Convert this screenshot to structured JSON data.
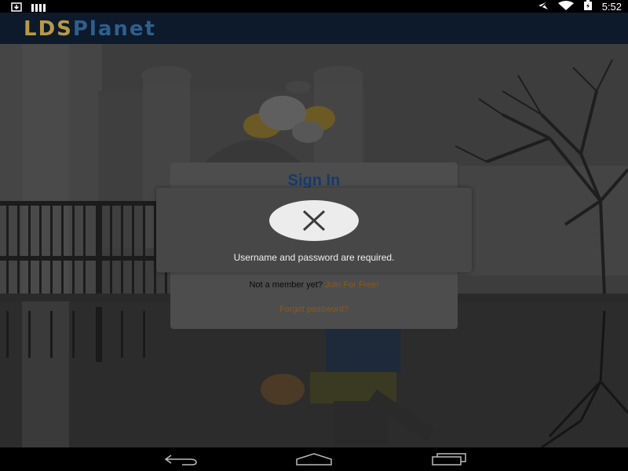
{
  "status_bar": {
    "time": "5:52",
    "left_icons": [
      "download-icon",
      "signal-bars-icon"
    ],
    "right_icons": [
      "airplane-mode-icon",
      "wifi-icon",
      "battery-icon"
    ]
  },
  "app_bar": {
    "logo_part1": "LDS",
    "logo_part2": "Planet",
    "colors": {
      "background": "#0c1a2c",
      "lds": "#b99a3f",
      "planet": "#2e5f8c"
    }
  },
  "signin_card": {
    "title": "Sign In",
    "member_prompt": "Not a member yet?",
    "join_link": "Join For Free!",
    "forgot_link": "Forgot password?"
  },
  "error_dialog": {
    "icon": "close-icon",
    "message": "Username and password are required."
  },
  "nav_bar": {
    "icons": [
      "back-icon",
      "home-icon",
      "recents-icon"
    ]
  }
}
